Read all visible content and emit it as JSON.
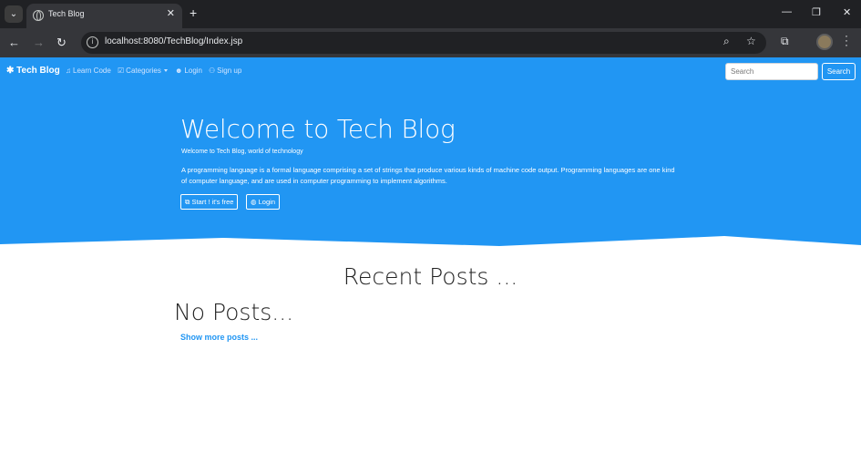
{
  "browser": {
    "tab_title": "Tech Blog",
    "url": "localhost:8080/TechBlog/Index.jsp",
    "icons": [
      "tab-search-icon",
      "globe-icon",
      "close-icon",
      "plus-icon",
      "minimize-icon",
      "restore-icon",
      "close-window-icon",
      "back-icon",
      "forward-icon",
      "reload-icon",
      "site-info-icon",
      "zoom-icon",
      "star-icon",
      "extensions-icon",
      "avatar",
      "menu-icon"
    ]
  },
  "navbar": {
    "brand": "Tech Blog",
    "items": [
      {
        "label": "Learn Code",
        "icon": "bell-icon"
      },
      {
        "label": "Categories",
        "icon": "check-square-icon"
      },
      {
        "label": "Login",
        "icon": "user-circle-icon"
      },
      {
        "label": "Sign up",
        "icon": "user-plus-icon"
      }
    ],
    "search_placeholder": "Search",
    "search_button": "Search"
  },
  "hero": {
    "title": "Welcome to Tech Blog",
    "subtitle": "Welcome to Tech Blog, world of technology",
    "description": "A programming language is a formal language comprising a set of strings that produce various kinds of machine code output. Programming languages are one kind of computer language, and are used in computer programming to implement algorithms.",
    "start_button": "Start ! it's free",
    "login_button": "Login"
  },
  "main": {
    "recent_title": "Recent Posts ...",
    "no_posts": "No Posts...",
    "show_more": "Show more posts ..."
  },
  "colors": {
    "primary": "#2196f3",
    "chrome_dark": "#202124",
    "chrome_toolbar": "#35363a"
  }
}
